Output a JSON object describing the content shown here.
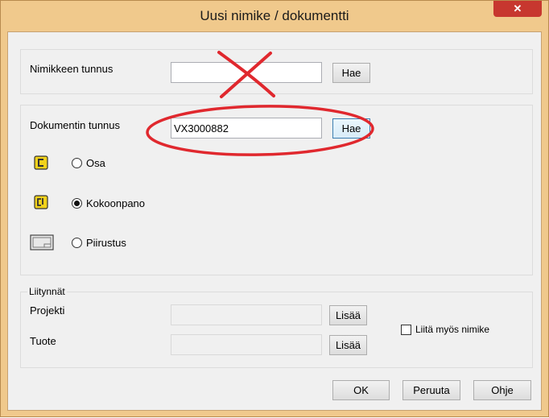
{
  "window": {
    "title": "Uusi nimike / dokumentti"
  },
  "item_section": {
    "label": "Nimikkeen tunnus",
    "value": "",
    "search_label": "Hae"
  },
  "document_section": {
    "label": "Dokumentin tunnus",
    "value": "VX3000882",
    "search_label": "Hae",
    "types": [
      {
        "label": "Osa",
        "selected": false,
        "icon": "part-icon"
      },
      {
        "label": "Kokoonpano",
        "selected": true,
        "icon": "assembly-icon"
      },
      {
        "label": "Piirustus",
        "selected": false,
        "icon": "drawing-icon"
      }
    ]
  },
  "links_section": {
    "title": "Liitynnät",
    "project_label": "Projekti",
    "product_label": "Tuote",
    "add_label": "Lisää",
    "also_link_item_label": "Liitä myös nimike",
    "also_link_item_checked": false
  },
  "footer": {
    "ok": "OK",
    "cancel": "Peruuta",
    "help": "Ohje"
  },
  "annotations": {
    "cross_color": "#e0282e",
    "ellipse_color": "#e0282e"
  }
}
